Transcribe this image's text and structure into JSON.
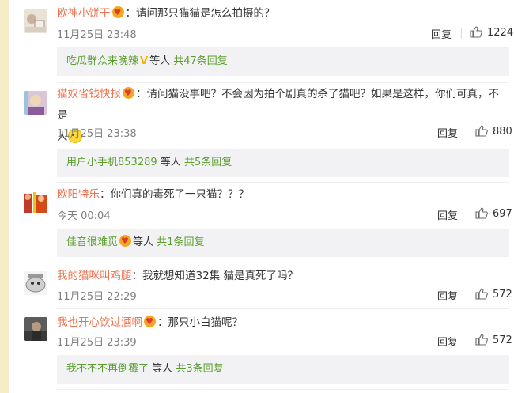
{
  "comments": [
    {
      "username": "欧神小饼干",
      "text": "：请问那只猫猫是怎么拍摄的？",
      "time": "11月25日 23:48",
      "reply_label": "回复",
      "likes": "1224",
      "sub": {
        "user": "吃瓜群众来晚辣",
        "suffix": "等人",
        "total": "共47条回复"
      }
    },
    {
      "username": "猫奴省钱快报",
      "text": "：请问猫没事吧？不会因为拍个剧真的杀了猫吧？如果是这样，你们可真，不是",
      "text2": "人",
      "time": "11月25日 23:38",
      "reply_label": "回复",
      "likes": "880",
      "sub": {
        "user": "用户小手机853289",
        "suffix": "等人",
        "total": "共5条回复"
      }
    },
    {
      "username": "欧阳特乐",
      "text": "：你们真的毒死了一只猫？？？",
      "time": "今天 00:04",
      "reply_label": "回复",
      "likes": "697",
      "sub": {
        "user": "佳音很难觅",
        "suffix": "等人",
        "total": "共1条回复"
      }
    },
    {
      "username": "我的猫咪叫鸡腿",
      "text": "：我就想知道32集 猫是真死了吗？",
      "time": "11月25日 22:29",
      "reply_label": "回复",
      "likes": "572"
    },
    {
      "username": "我也开心饮过酒啊",
      "text": "：那只小白猫呢？",
      "time": "11月25日 23:39",
      "reply_label": "回复",
      "likes": "572",
      "sub": {
        "user": "我不不不再倒霉了",
        "suffix": "等人",
        "total": "共3条回复"
      }
    }
  ],
  "colors": {
    "username": "#eb7350",
    "link": "#5a9f2c",
    "time": "#808080",
    "sub_bg": "#f2f2f5"
  }
}
